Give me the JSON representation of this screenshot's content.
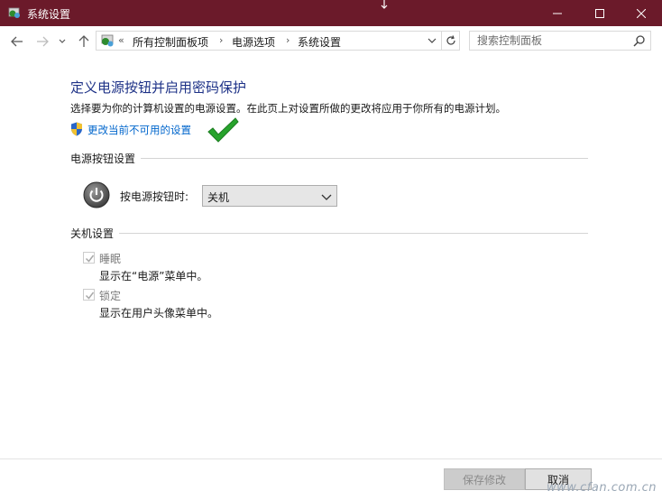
{
  "window": {
    "title": "系统设置",
    "accent": "#6b1a2a"
  },
  "address": {
    "overflow": "«",
    "crumbs": [
      "所有控制面板项",
      "电源选项",
      "系统设置"
    ],
    "separator": "›"
  },
  "search": {
    "placeholder": "搜索控制面板"
  },
  "main": {
    "heading": "定义电源按钮并启用密码保护",
    "description": "选择要为你的计算机设置的电源设置。在此页上对设置所做的更改将应用于你所有的电源计划。",
    "change_link": "更改当前不可用的设置"
  },
  "power_section": {
    "title": "电源按钮设置",
    "label": "按电源按钮时:",
    "selected": "关机"
  },
  "shutdown_section": {
    "title": "关机设置",
    "items": [
      {
        "label": "睡眠",
        "desc": "显示在“电源”菜单中。",
        "checked": true
      },
      {
        "label": "锁定",
        "desc": "显示在用户头像菜单中。",
        "checked": true
      }
    ]
  },
  "footer": {
    "save_label": "保存修改",
    "cancel_label": "取消"
  },
  "watermark": "www.cfan.com.cn"
}
